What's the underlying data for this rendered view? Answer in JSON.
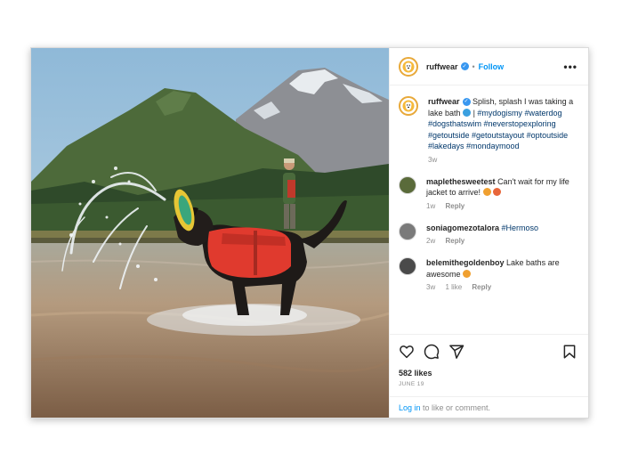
{
  "post": {
    "username": "ruffwear",
    "follow_label": "Follow",
    "dot": "•",
    "more_label": "•••",
    "caption": {
      "username": "ruffwear",
      "text": "Splish, splash I was taking a lake bath",
      "pipe": "|",
      "hashtags": "#mydogismy #waterdog #dogsthatswim #neverstopexploring #getoutside #getoutstayout #optoutside #lakedays #mondaymood",
      "time": "3w"
    },
    "comments": [
      {
        "username": "maplethesweetest",
        "text": "Can't wait for my life jacket to arrive!",
        "time": "1w",
        "likes": "",
        "reply": "Reply",
        "emoji_colors": [
          "#f0a030",
          "#e8663a"
        ]
      },
      {
        "username": "soniagomezotalora",
        "text": "#Hermoso",
        "time": "2w",
        "likes": "",
        "reply": "Reply",
        "emoji_colors": []
      },
      {
        "username": "belemithegoldenboy",
        "text": "Lake baths are awesome",
        "time": "3w",
        "likes": "1 like",
        "reply": "Reply",
        "emoji_colors": [
          "#f0a030"
        ]
      }
    ],
    "likes": "582 likes",
    "date": "JUNE 19",
    "login_link": "Log in",
    "login_text": " to like or comment."
  },
  "colors": {
    "link": "#0095f6",
    "hashtag": "#00376b",
    "verified": "#3897f0",
    "vest": "#e03a2e"
  },
  "icons": [
    "heart-icon",
    "comment-icon",
    "share-icon",
    "bookmark-icon",
    "verified-icon",
    "more-icon"
  ]
}
